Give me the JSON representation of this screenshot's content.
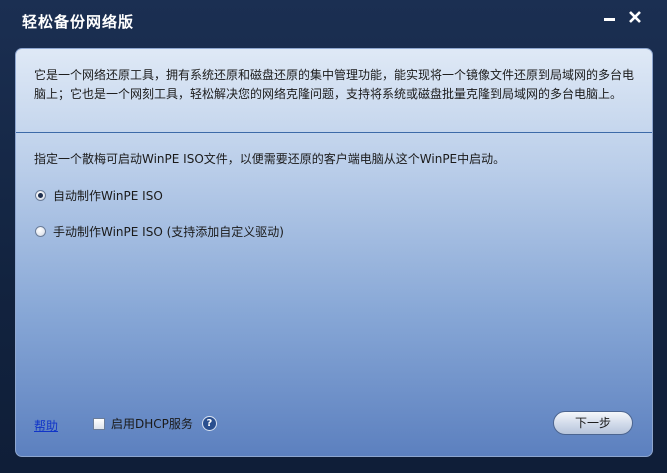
{
  "window": {
    "title": "轻松备份网络版"
  },
  "content": {
    "description": "它是一个网络还原工具，拥有系统还原和磁盘还原的集中管理功能，能实现将一个镜像文件还原到局域网的多台电脑上；它也是一个网刻工具，轻松解决您的网络克隆问题，支持将系统或磁盘批量克隆到局域网的多台电脑上。",
    "instruction": "指定一个散梅可启动WinPE ISO文件，以便需要还原的客户端电脑从这个WinPE中启动。",
    "options": [
      {
        "label": "自动制作WinPE ISO",
        "selected": true
      },
      {
        "label": "手动制作WinPE ISO (支持添加自定义驱动)",
        "selected": false
      }
    ]
  },
  "footer": {
    "help_label": "帮助",
    "dhcp_label": "启用DHCP服务",
    "dhcp_checked": false,
    "help_icon": "question-mark-icon",
    "next_label": "下一步"
  },
  "icons": {
    "minimize": "minimize-icon",
    "close": "close-icon"
  },
  "colors": {
    "title_bg": "#1b2f52",
    "panel_top": "#dfe9f6",
    "panel_bottom": "#5c80bf",
    "link": "#1034c8"
  }
}
